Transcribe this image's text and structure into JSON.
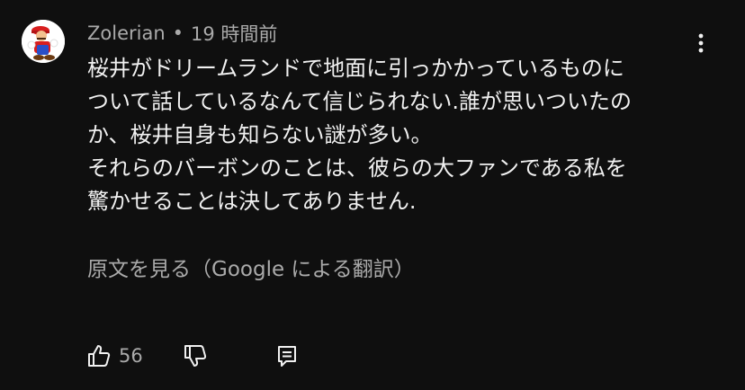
{
  "comment": {
    "author": "Zolerian",
    "separator": "•",
    "time": "19 時間前",
    "lines": [
      "桜井がドリームランドで地面に引っかかっているものに",
      "ついて話しているなんて信じられない.誰が思いついたの",
      "か、桜井自身も知らない謎が多い。",
      "それらのバーボンのことは、彼らの大ファンである私を",
      "驚かせることは決してありません."
    ],
    "translate_label": "原文を見る（Google による翻訳）",
    "like_count": "56"
  },
  "icons": {
    "avatar": "mario-avatar",
    "more": "more-vert-icon",
    "like": "thumb-up-icon",
    "dislike": "thumb-down-icon",
    "reply": "reply-comment-icon"
  },
  "colors": {
    "background": "#0f0f0f",
    "primary_text": "#f1f1f1",
    "secondary_text": "#aaaaaa"
  }
}
